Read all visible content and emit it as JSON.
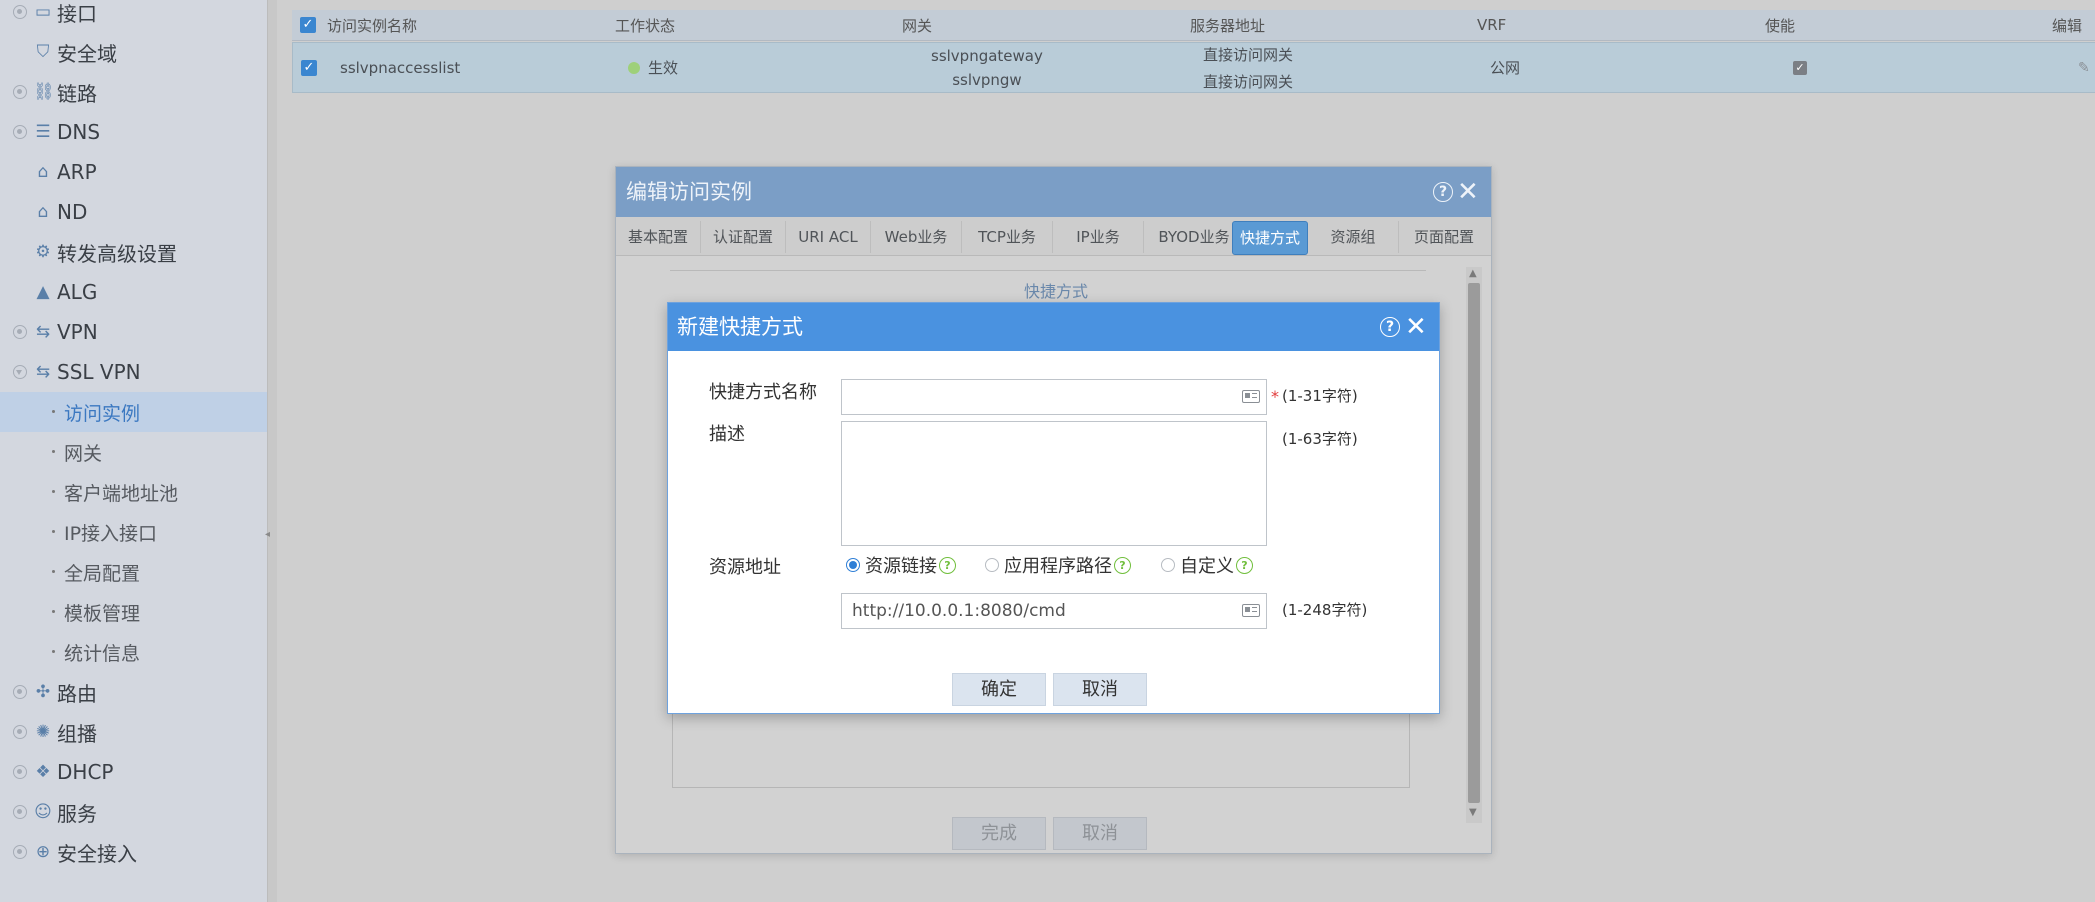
{
  "sidebar": {
    "items": [
      {
        "label": "接口",
        "icon": "interface-icon"
      },
      {
        "label": "安全域",
        "icon": "shield-icon"
      },
      {
        "label": "链路",
        "icon": "link-icon"
      },
      {
        "label": "DNS",
        "icon": "database-icon"
      },
      {
        "label": "ARP",
        "icon": "arp-icon"
      },
      {
        "label": "ND",
        "icon": "nd-icon"
      },
      {
        "label": "转发高级设置",
        "icon": "forward-settings-icon"
      },
      {
        "label": "ALG",
        "icon": "alg-icon"
      },
      {
        "label": "VPN",
        "icon": "vpn-icon"
      },
      {
        "label": "SSL VPN",
        "icon": "ssl-vpn-icon"
      },
      {
        "label": "路由",
        "icon": "route-icon"
      },
      {
        "label": "组播",
        "icon": "multicast-icon"
      },
      {
        "label": "DHCP",
        "icon": "dhcp-icon"
      },
      {
        "label": "服务",
        "icon": "service-icon"
      },
      {
        "label": "安全接入",
        "icon": "secure-access-icon"
      }
    ],
    "ssl_children": [
      "访问实例",
      "网关",
      "客户端地址池",
      "IP接入接口",
      "全局配置",
      "模板管理",
      "统计信息"
    ]
  },
  "table": {
    "headers": [
      "访问实例名称",
      "工作状态",
      "网关",
      "服务器地址",
      "VRF",
      "使能",
      "编辑"
    ],
    "row": {
      "name": "sslvpnaccesslist",
      "status": "生效",
      "gateways": [
        "sslvpngateway",
        "sslvpngw"
      ],
      "servers": [
        "直接访问网关",
        "直接访问网关"
      ],
      "vrf": "公网"
    }
  },
  "outer_dialog": {
    "title": "编辑访问实例",
    "tabs": [
      "基本配置",
      "认证配置",
      "URI ACL",
      "Web业务",
      "TCP业务",
      "IP业务",
      "BYOD业务",
      "快捷方式",
      "资源组",
      "页面配置"
    ],
    "active_tab": "快捷方式",
    "section_title": "快捷方式",
    "finish_label": "完成",
    "cancel_label": "取消"
  },
  "inner_dialog": {
    "title": "新建快捷方式",
    "name_label": "快捷方式名称",
    "name_value": "",
    "name_hint": "(1-31字符)",
    "desc_label": "描述",
    "desc_hint": "(1-63字符)",
    "resource_label": "资源地址",
    "radio_options": [
      "资源链接",
      "应用程序路径",
      "自定义"
    ],
    "selected_radio": "资源链接",
    "resource_value": "http://10.0.0.1:8080/cmd",
    "resource_hint": "(1-248字符)",
    "ok_label": "确定",
    "cancel_label": "取消"
  },
  "colors": {
    "accent": "#4a92e0",
    "active_tab": "#5a9ad4",
    "status_ok": "#9ed07a",
    "help_green": "#71bf3d"
  }
}
